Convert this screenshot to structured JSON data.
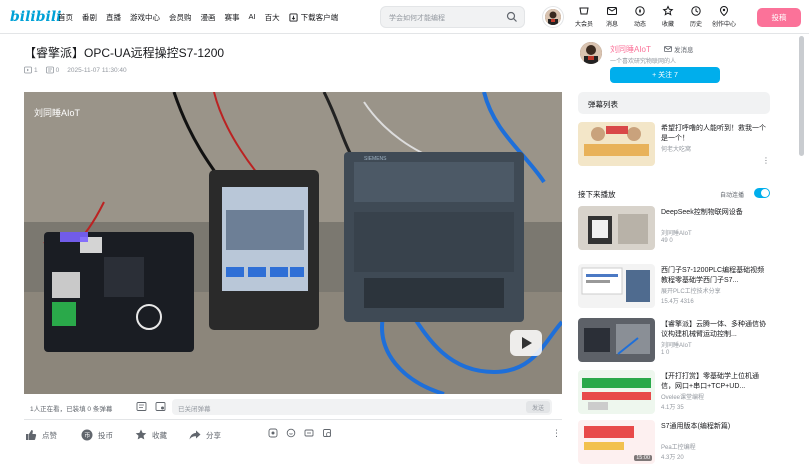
{
  "header": {
    "logo": "bilibili",
    "nav": [
      "首页",
      "番剧",
      "直播",
      "游戏中心",
      "会员购",
      "漫画",
      "赛事",
      "AI",
      "百大"
    ],
    "download": "下载客户端",
    "search_placeholder": "学会如何才能编程",
    "top_icons": [
      {
        "icon": "vip-icon",
        "label": "大会员"
      },
      {
        "icon": "message-icon",
        "label": "消息"
      },
      {
        "icon": "dynamic-icon",
        "label": "动态"
      },
      {
        "icon": "star-icon",
        "label": "收藏"
      },
      {
        "icon": "history-icon",
        "label": "历史"
      },
      {
        "icon": "creator-icon",
        "label": "创作中心"
      }
    ],
    "upload": "投稿"
  },
  "video": {
    "title": "【睿擎派】OPC-UA远程操控S7-1200",
    "views": "1",
    "danmaku_count": "0",
    "date": "2025-11-07 11:30:40",
    "watermark": "刘同睡AIoT",
    "viewers_text": "1人正在看，已装填 0 条弹幕",
    "danmaku_placeholder": "已关闭弹幕",
    "send_label": "发送"
  },
  "toolbar": {
    "like": "点赞",
    "coin": "投币",
    "favorite": "收藏",
    "share": "分享"
  },
  "up": {
    "name": "刘同睡AIoT",
    "message": "发消息",
    "desc": "一个喜欢研究物联网的人",
    "follow": "+ 关注 7"
  },
  "sidebar": {
    "collection_label": "弹幕列表",
    "autoplay_label": "接下来播放",
    "autoplay_toggle": "自动连播",
    "first": {
      "title": "希望打呼噜的人能听到！救我一个是一个！",
      "up": "何老大吃窝",
      "duration": ""
    },
    "recs": [
      {
        "title": "DeepSeek控制物联网设备",
        "up": "刘同睡AIoT",
        "stats": "49  0",
        "duration": ""
      },
      {
        "title": "西门子S7-1200PLC编程基础视频教程零基础学西门子S7...",
        "up": "展开PLC工控技术分享",
        "stats": "15.4万  4316",
        "duration": ""
      },
      {
        "title": "【睿擎派】云腾一体、多种通信协议构建机械臂运动控制...",
        "up": "刘同睡AIoT",
        "stats": "1  0",
        "duration": ""
      },
      {
        "title": "【开打打赏】零基础学上位机通信，网口+串口+TCP+UD...",
        "up": "Ovelee课堂编程",
        "stats": "4.1万  35",
        "duration": ""
      },
      {
        "title": "S7通用版本(编程新篇)",
        "up": "Pea工控编程",
        "stats": "4.3万  20",
        "duration": "15:00"
      }
    ]
  }
}
